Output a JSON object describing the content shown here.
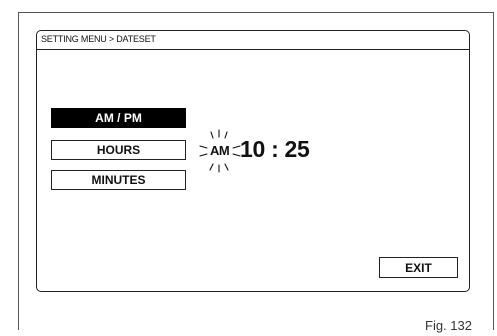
{
  "breadcrumb": "SETTING MENU > DATESET",
  "menu": {
    "items": [
      {
        "label": "AM / PM",
        "selected": true
      },
      {
        "label": "HOURS",
        "selected": false
      },
      {
        "label": "MINUTES",
        "selected": false
      }
    ]
  },
  "clock": {
    "ampm": "AM",
    "time": "10 : 25",
    "ampm_blinking": true
  },
  "exit_label": "EXIT",
  "figure_caption": "Fig. 132",
  "colors": {
    "selected_bg": "#000000",
    "selected_fg": "#ffffff",
    "border": "#222222"
  }
}
